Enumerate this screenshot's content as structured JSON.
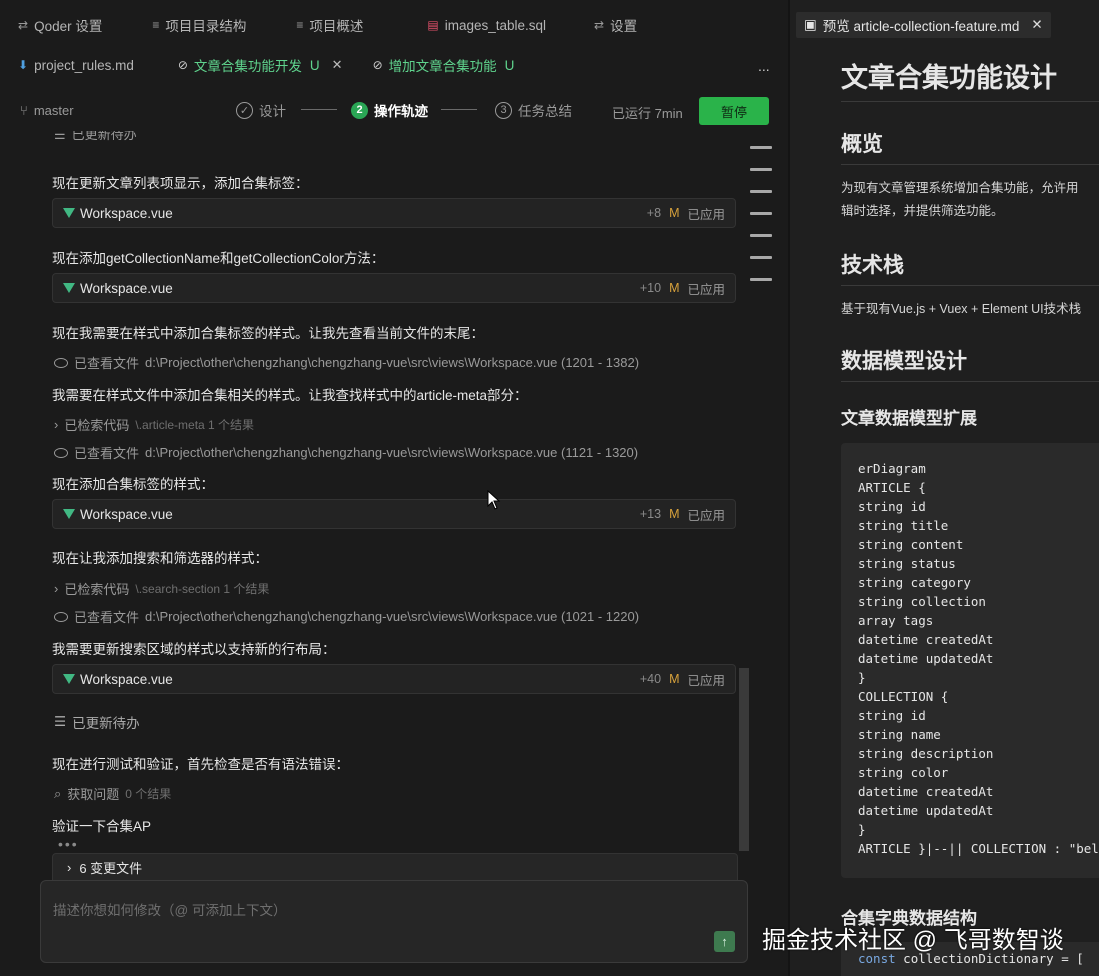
{
  "tabs_row1": [
    {
      "icon": "⇄",
      "label": "Qoder 设置"
    },
    {
      "icon": "≡",
      "label": "项目目录结构"
    },
    {
      "icon": "≡",
      "label": "项目概述"
    },
    {
      "icon": "▤",
      "label": "images_table.sql"
    },
    {
      "icon": "⇄",
      "label": "设置"
    }
  ],
  "tabs_row2": [
    {
      "icon": "⬇",
      "label": "project_rules.md"
    },
    {
      "icon": "⊘",
      "label": "文章合集功能开发",
      "badge": "U",
      "close": "✕"
    },
    {
      "icon": "⊘",
      "label": "增加文章合集功能",
      "badge": "U"
    }
  ],
  "more": "...",
  "progress": {
    "branch": "master",
    "steps": [
      {
        "num": "✓",
        "label": "设计"
      },
      {
        "num": "2",
        "label": "操作轨迹"
      },
      {
        "num": "3",
        "label": "任务总结"
      }
    ],
    "runtime": "已运行 7min",
    "pause_label": "暂停"
  },
  "feed": {
    "top_partial": "已更新待办",
    "m1": "现在更新文章列表项显示，添加合集标签：",
    "m2": "现在添加getCollectionName和getCollectionColor方法：",
    "m3": "现在我需要在样式中添加合集标签的样式。让我先查看当前文件的末尾：",
    "m4": "我需要在样式文件中添加合集相关的样式。让我查找样式中的article-meta部分：",
    "m5": "现在添加合集标签的样式：",
    "m6": "现在让我添加搜索和筛选器的样式：",
    "m7": "我需要更新搜索区域的样式以支持新的行布局：",
    "todo": "已更新待办",
    "m8": "现在进行测试和验证，首先检查是否有语法错误：",
    "m9": "验证一下合集AP",
    "cards": [
      {
        "file": "Workspace.vue",
        "plus": "+8",
        "m": "M",
        "status": "已应用"
      },
      {
        "file": "Workspace.vue",
        "plus": "+10",
        "m": "M",
        "status": "已应用"
      },
      {
        "file": "Workspace.vue",
        "plus": "+13",
        "m": "M",
        "status": "已应用"
      },
      {
        "file": "Workspace.vue",
        "plus": "+40",
        "m": "M",
        "status": "已应用"
      }
    ],
    "view1": {
      "label": "已查看文件",
      "path": "d:\\Project\\other\\chengzhang\\chengzhang-vue\\src\\views\\Workspace.vue (1201 - 1382)"
    },
    "search1": {
      "label": "已检索代码",
      "query": "\\.article-meta 1 个结果"
    },
    "view2": {
      "label": "已查看文件",
      "path": "d:\\Project\\other\\chengzhang\\chengzhang-vue\\src\\views\\Workspace.vue (1121 - 1320)"
    },
    "search2": {
      "label": "已检索代码",
      "query": "\\.search-section 1 个结果"
    },
    "view3": {
      "label": "已查看文件",
      "path": "d:\\Project\\other\\chengzhang\\chengzhang-vue\\src\\views\\Workspace.vue (1021 - 1220)"
    },
    "problems": {
      "label": "获取问题",
      "query": "0 个结果"
    }
  },
  "changed_files": "6 变更文件",
  "input_placeholder": "描述你想如何修改（@ 可添加上下文）",
  "preview": {
    "tab_label": "预览 article-collection-feature.md",
    "h1": "文章合集功能设计",
    "h2_overview": "概览",
    "overview_l1": "为现有文章管理系统增加合集功能，允许用",
    "overview_l2": "辑时选择，并提供筛选功能。",
    "h2_stack": "技术栈",
    "stack_text": "基于现有Vue.js + Vuex + Element UI技术栈",
    "h2_model": "数据模型设计",
    "h3_ext": "文章数据模型扩展",
    "code": "erDiagram\nARTICLE {\nstring id\nstring title\nstring content\nstring status\nstring category\nstring collection\narray tags\ndatetime createdAt\ndatetime updatedAt\n}\nCOLLECTION {\nstring id\nstring name\nstring description\nstring color\ndatetime createdAt\ndatetime updatedAt\n}\nARTICLE }|--|| COLLECTION : \"belongs",
    "h3_dict": "合集字典数据结构",
    "code2_kw": "const",
    "code2_rest": " collectionDictionary = ["
  },
  "watermark": "掘金技术社区 @ 飞哥数智谈"
}
